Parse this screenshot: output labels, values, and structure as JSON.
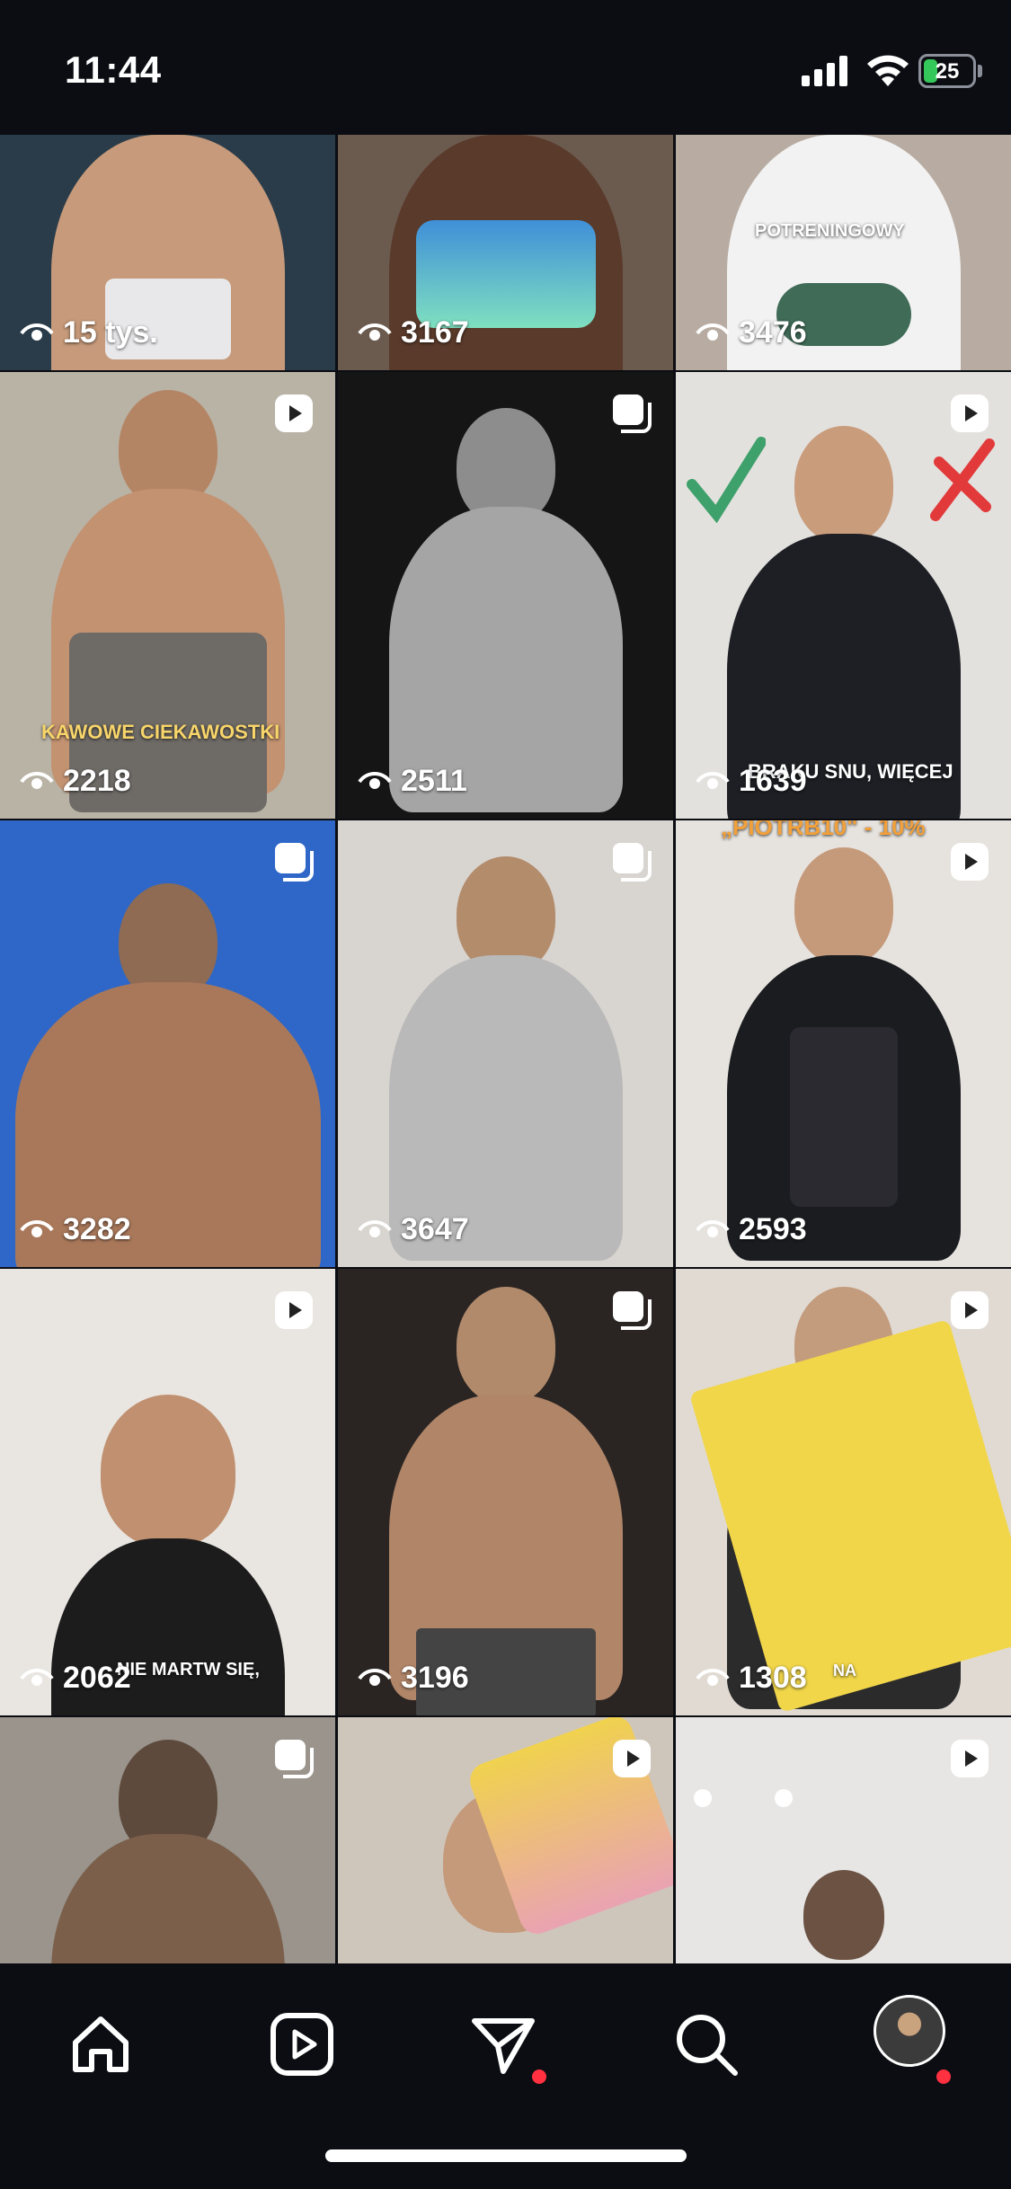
{
  "status_bar": {
    "time": "11:44",
    "battery": "25",
    "battery_level": 0.25
  },
  "tiles": [
    {
      "views": "15 tys.",
      "type": "none",
      "bg": "#2a3c4a"
    },
    {
      "views": "3167",
      "type": "none",
      "bg": "#6b5a4e"
    },
    {
      "views": "3476",
      "type": "none",
      "bg": "#b8aca2",
      "overlay": "POTRENINGOWY"
    },
    {
      "views": "2218",
      "type": "reel",
      "bg": "#b9b3a6",
      "overlay": "KAWOWE CIEKAWOSTKI"
    },
    {
      "views": "2511",
      "type": "carousel",
      "bg": "#151515"
    },
    {
      "views": "1639",
      "type": "reel",
      "bg": "#e2e1de",
      "overlay": "BRAKU SNU, WIĘCEJ"
    },
    {
      "views": "3282",
      "type": "carousel",
      "bg": "#2f67c8"
    },
    {
      "views": "3647",
      "type": "carousel",
      "bg": "#d8d4cf"
    },
    {
      "views": "2593",
      "type": "reel",
      "bg": "#e6e3df",
      "overlay": "„PIOTRB10\" - 10%"
    },
    {
      "views": "2062",
      "type": "reel",
      "bg": "#e9e6e1",
      "overlay": "NIE MARTW SIĘ,"
    },
    {
      "views": "3196",
      "type": "carousel",
      "bg": "#2a2523"
    },
    {
      "views": "1308",
      "type": "reel",
      "bg": "#e0dad2",
      "overlay": "NA"
    },
    {
      "views": "",
      "type": "carousel",
      "bg": "#9a948c"
    },
    {
      "views": "",
      "type": "reel",
      "bg": "#cfc6bb"
    },
    {
      "views": "",
      "type": "reel",
      "bg": "#e7e6e4"
    }
  ],
  "bottom_nav": {
    "items": [
      "home-icon",
      "reels-icon",
      "direct-icon",
      "search-icon",
      "profile-avatar"
    ]
  }
}
